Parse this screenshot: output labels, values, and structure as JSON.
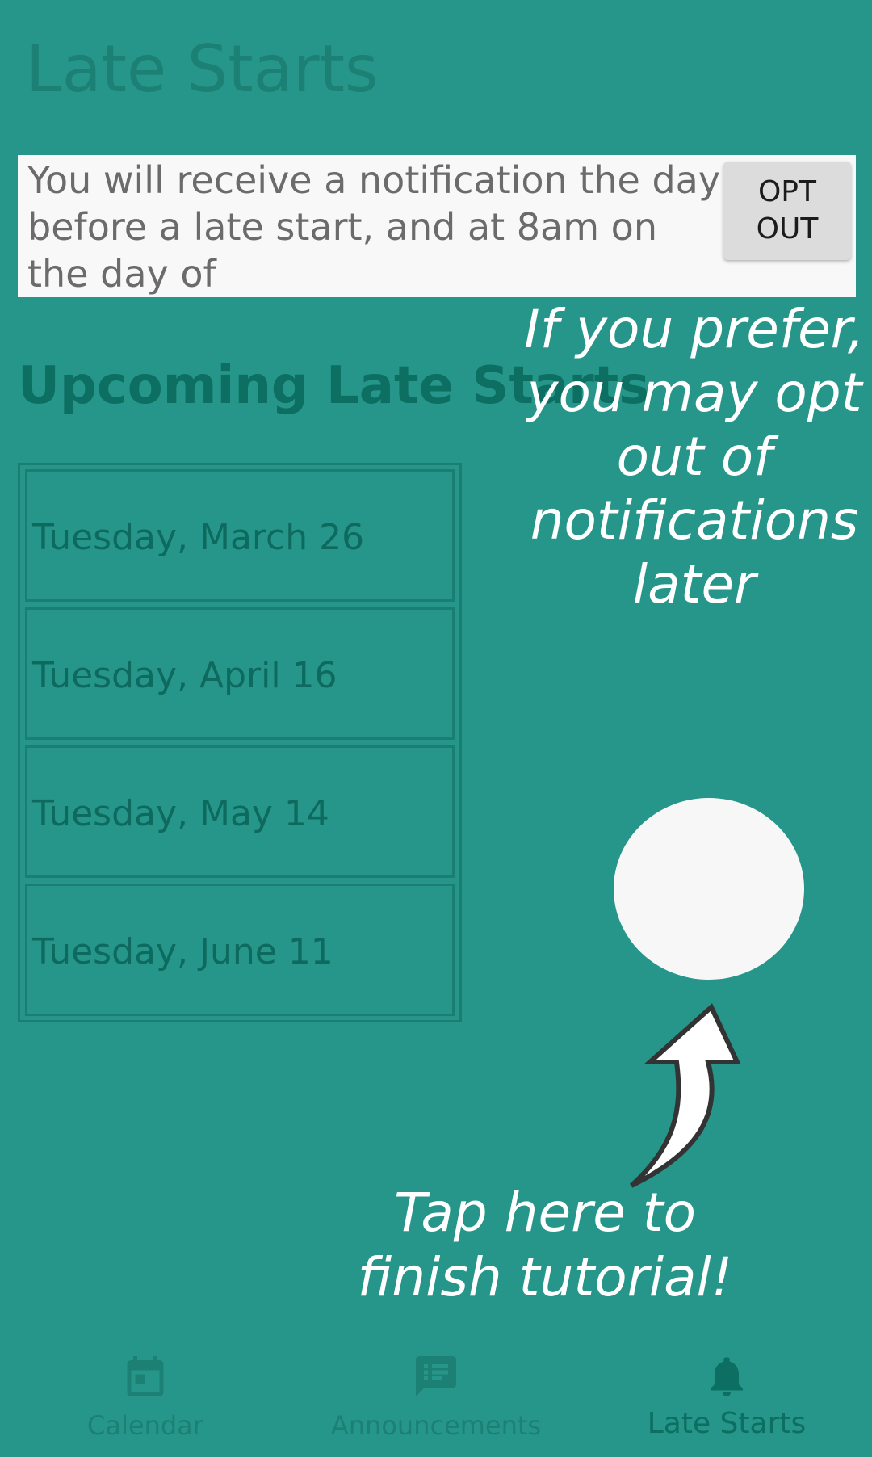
{
  "page_title": "Late Starts",
  "notice": {
    "text": "You will receive a notification the day before a late start, and at 8am on the day of",
    "opt_out_label": "OPT\nOUT"
  },
  "upcoming": {
    "heading": "Upcoming Late Starts",
    "dates": [
      "Tuesday, March 26",
      "Tuesday, April 16",
      "Tuesday, May 14",
      "Tuesday, June 11"
    ]
  },
  "tutorial": {
    "hint_opt_out": "If you prefer, you may opt out of notifications later",
    "hint_finish": "Tap here to finish tutorial!"
  },
  "bottom_nav": {
    "items": [
      {
        "label": "Calendar",
        "icon": "calendar-icon"
      },
      {
        "label": "Announcements",
        "icon": "announcements-icon"
      },
      {
        "label": "Late Starts",
        "icon": "bell-icon",
        "active": true
      }
    ]
  },
  "colors": {
    "background": "#259689",
    "dim_text": "#1c8074",
    "dark_teal": "#0d6e62",
    "overlay_white": "#ffffff"
  }
}
